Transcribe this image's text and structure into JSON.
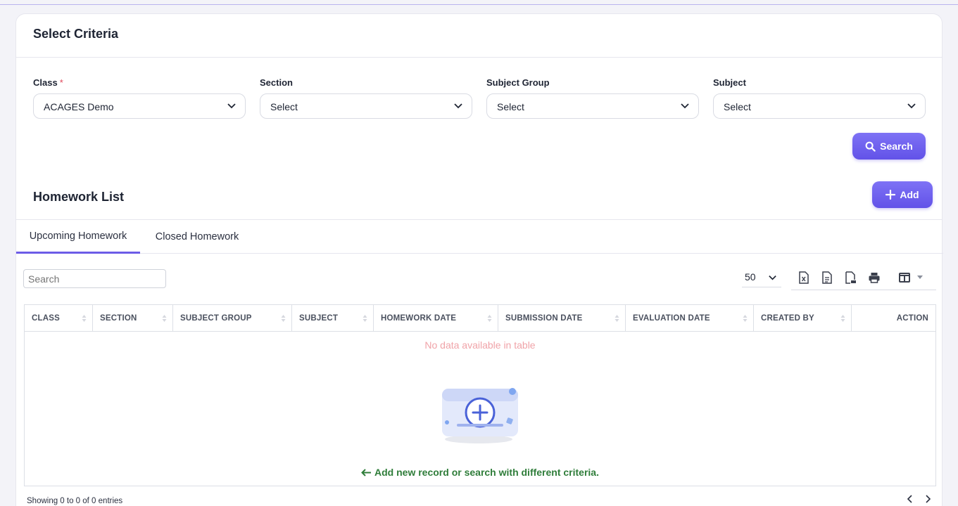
{
  "criteria": {
    "title": "Select Criteria",
    "class": {
      "label": "Class",
      "required_mark": "*",
      "value": "ACAGES Demo"
    },
    "section": {
      "label": "Section",
      "value": "Select"
    },
    "subject_group": {
      "label": "Subject Group",
      "value": "Select"
    },
    "subject": {
      "label": "Subject",
      "value": "Select"
    },
    "search_button": "Search"
  },
  "homework": {
    "title": "Homework List",
    "add_button": "Add",
    "tabs": [
      {
        "label": "Upcoming Homework",
        "active": true
      },
      {
        "label": "Closed Homework",
        "active": false
      }
    ],
    "search_placeholder": "Search",
    "per_page": "50",
    "toolbar_icons": [
      "excel-export-icon",
      "csv-export-icon",
      "pdf-export-icon",
      "print-icon",
      "columns-icon"
    ],
    "columns": [
      "CLASS",
      "SECTION",
      "SUBJECT GROUP",
      "SUBJECT",
      "HOMEWORK DATE",
      "SUBMISSION DATE",
      "EVALUATION DATE",
      "CREATED BY",
      "ACTION"
    ],
    "empty_text": "No data available in table",
    "add_hint": "Add new record or search with different criteria.",
    "showing": "Showing 0 to 0 of 0 entries"
  },
  "colors": {
    "accent": "#6c5ce7",
    "hint": "#2f7d3a",
    "empty": "#f0a3a8"
  }
}
